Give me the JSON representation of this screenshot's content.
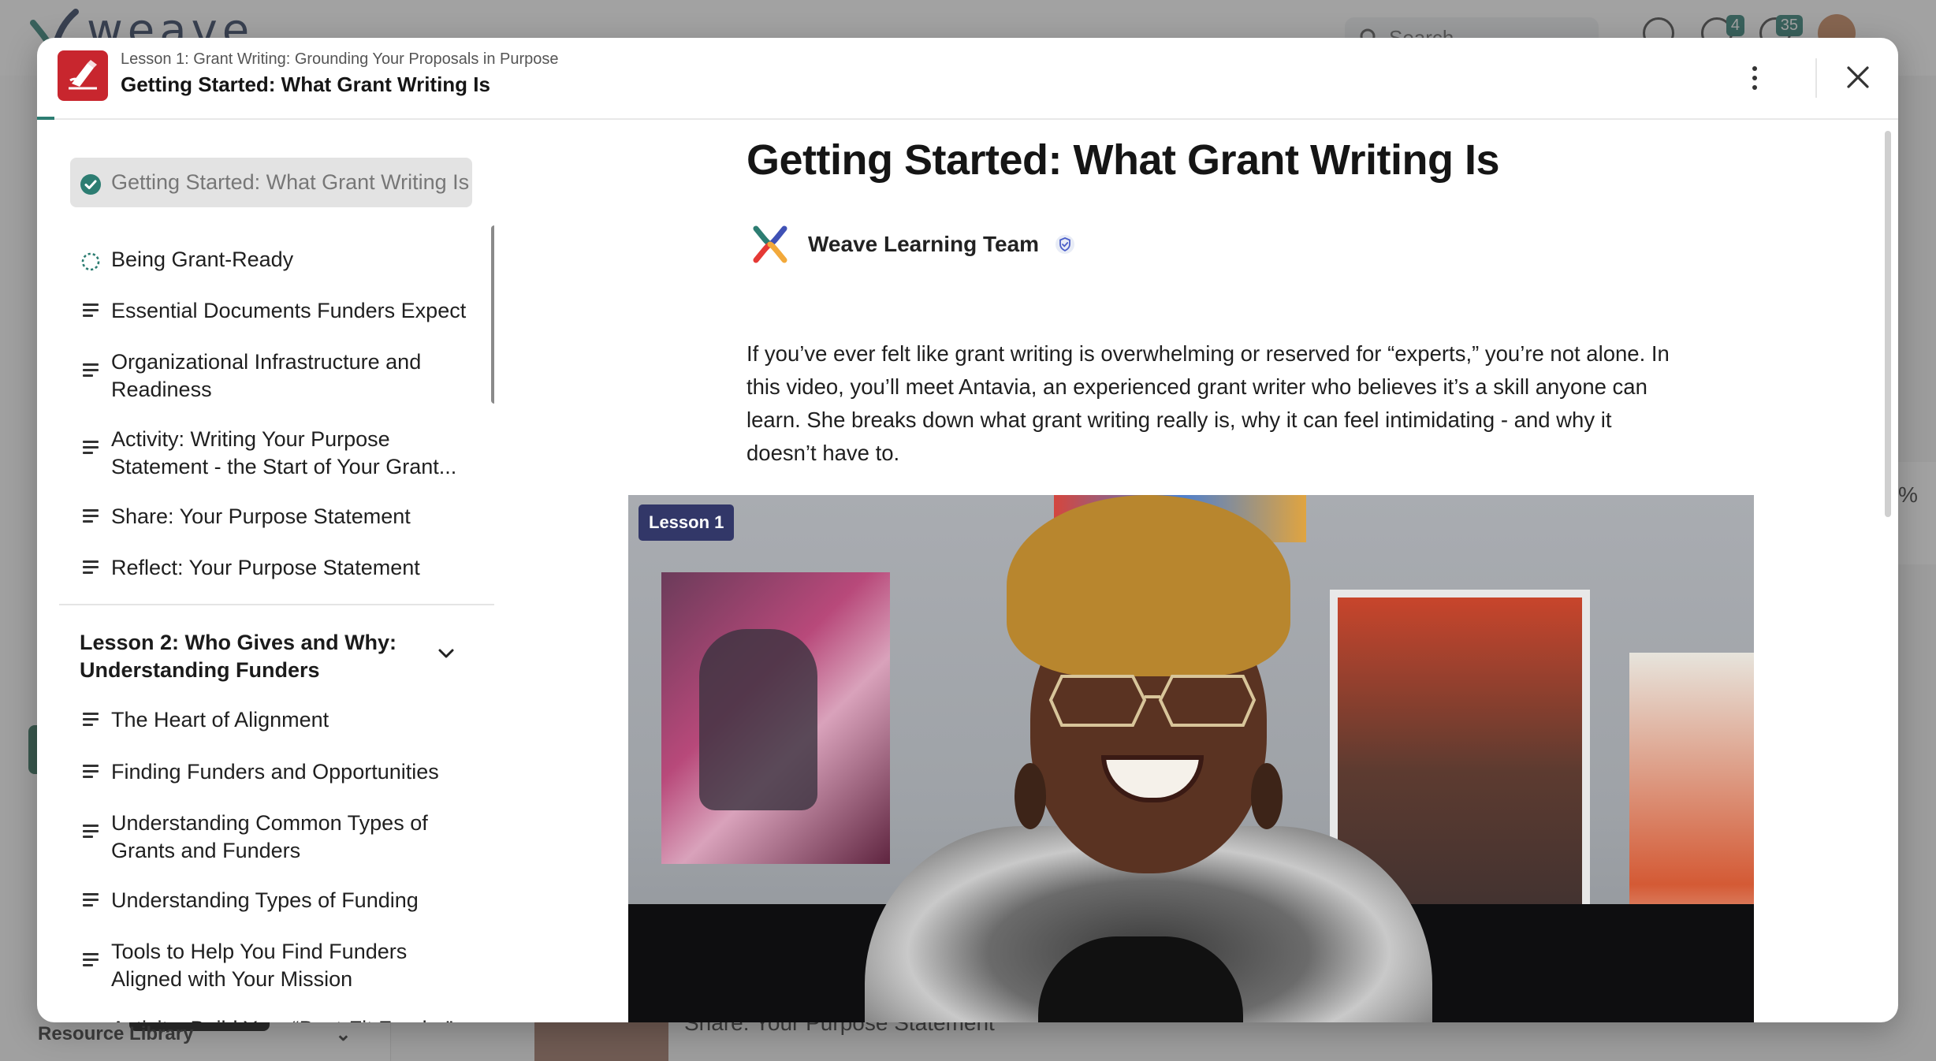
{
  "background": {
    "logo_text": "weave",
    "search_placeholder": "Search",
    "badges": {
      "notifications": "4",
      "messages": "35"
    },
    "sidebar_footer": "Resource Library",
    "behind_item": "Share: Your Purpose Statement",
    "right_panel_text": "%"
  },
  "header": {
    "subtitle": "Lesson 1: Grant Writing: Grounding Your Proposals in Purpose",
    "title": "Getting Started: What Grant Writing Is"
  },
  "sidebar": {
    "lesson1_items": [
      {
        "label": "Getting Started: What Grant Writing Is",
        "status": "complete",
        "icon": "check-circle-icon"
      },
      {
        "label": "Being Grant-Ready",
        "status": "in-progress",
        "icon": "dashed-circle-icon"
      },
      {
        "label": "Essential Documents Funders Expect",
        "icon": "text-lines-icon"
      },
      {
        "label": "Organizational Infrastructure and Readiness",
        "icon": "text-lines-icon"
      },
      {
        "label": "Activity: Writing Your Purpose Statement - the Start of Your Grant...",
        "icon": "text-lines-icon"
      },
      {
        "label": "Share: Your Purpose Statement",
        "icon": "text-lines-icon"
      },
      {
        "label": "Reflect: Your Purpose Statement",
        "icon": "text-lines-icon"
      }
    ],
    "lesson2_heading": "Lesson 2: Who Gives and Why: Understanding Funders",
    "lesson2_items": [
      {
        "label": "The Heart of Alignment",
        "icon": "text-lines-icon"
      },
      {
        "label": "Finding Funders and Opportunities",
        "icon": "text-lines-icon"
      },
      {
        "label": "Understanding Common Types of Grants and Funders",
        "icon": "text-lines-icon"
      },
      {
        "label": "Understanding Types of Funding",
        "icon": "text-lines-icon"
      },
      {
        "label": "Tools to Help You Find Funders Aligned with Your Mission",
        "icon": "text-lines-icon"
      },
      {
        "label": "Activity: Build Your “Best-Fit Funder” Profile",
        "icon": "text-lines-icon"
      }
    ]
  },
  "content": {
    "title": "Getting Started: What Grant Writing Is",
    "author": "Weave Learning Team",
    "description": "If you’ve ever felt like grant writing is overwhelming or reserved for “experts,” you’re not alone. In this video, you’ll meet Antavia, an experienced grant writer who believes it’s a skill anyone can learn. She breaks down what grant writing really is, why it can feel intimidating -  and why it doesn’t have to.",
    "video_badge": "Lesson 1"
  },
  "colors": {
    "accent": "#2d7d72",
    "course_logo": "#c8262e",
    "video_badge": "#323768"
  }
}
